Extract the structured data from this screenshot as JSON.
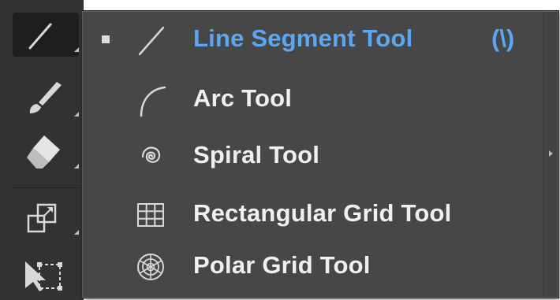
{
  "toolbar": {
    "tools": [
      {
        "name": "line-segment-tool",
        "icon": "line-segment-icon",
        "active": true
      },
      {
        "name": "paintbrush-tool",
        "icon": "paintbrush-icon",
        "active": false
      },
      {
        "name": "eraser-tool",
        "icon": "eraser-icon",
        "active": false
      },
      {
        "name": "scale-tool",
        "icon": "scale-icon",
        "active": false
      },
      {
        "name": "free-transform-tool",
        "icon": "free-transform-icon",
        "active": false
      }
    ]
  },
  "flyout": {
    "items": [
      {
        "label": "Line Segment Tool",
        "shortcut": "(\\)",
        "icon": "line-segment-icon",
        "selected": true
      },
      {
        "label": "Arc Tool",
        "shortcut": "",
        "icon": "arc-icon",
        "selected": false
      },
      {
        "label": "Spiral Tool",
        "shortcut": "",
        "icon": "spiral-icon",
        "selected": false
      },
      {
        "label": "Rectangular Grid Tool",
        "shortcut": "",
        "icon": "rectangular-grid-icon",
        "selected": false
      },
      {
        "label": "Polar Grid Tool",
        "shortcut": "",
        "icon": "polar-grid-icon",
        "selected": false
      }
    ]
  },
  "colors": {
    "accent": "#5aa8f5",
    "panel_bg": "#474747",
    "toolbar_bg": "#323232",
    "text": "#f0f0f0"
  }
}
